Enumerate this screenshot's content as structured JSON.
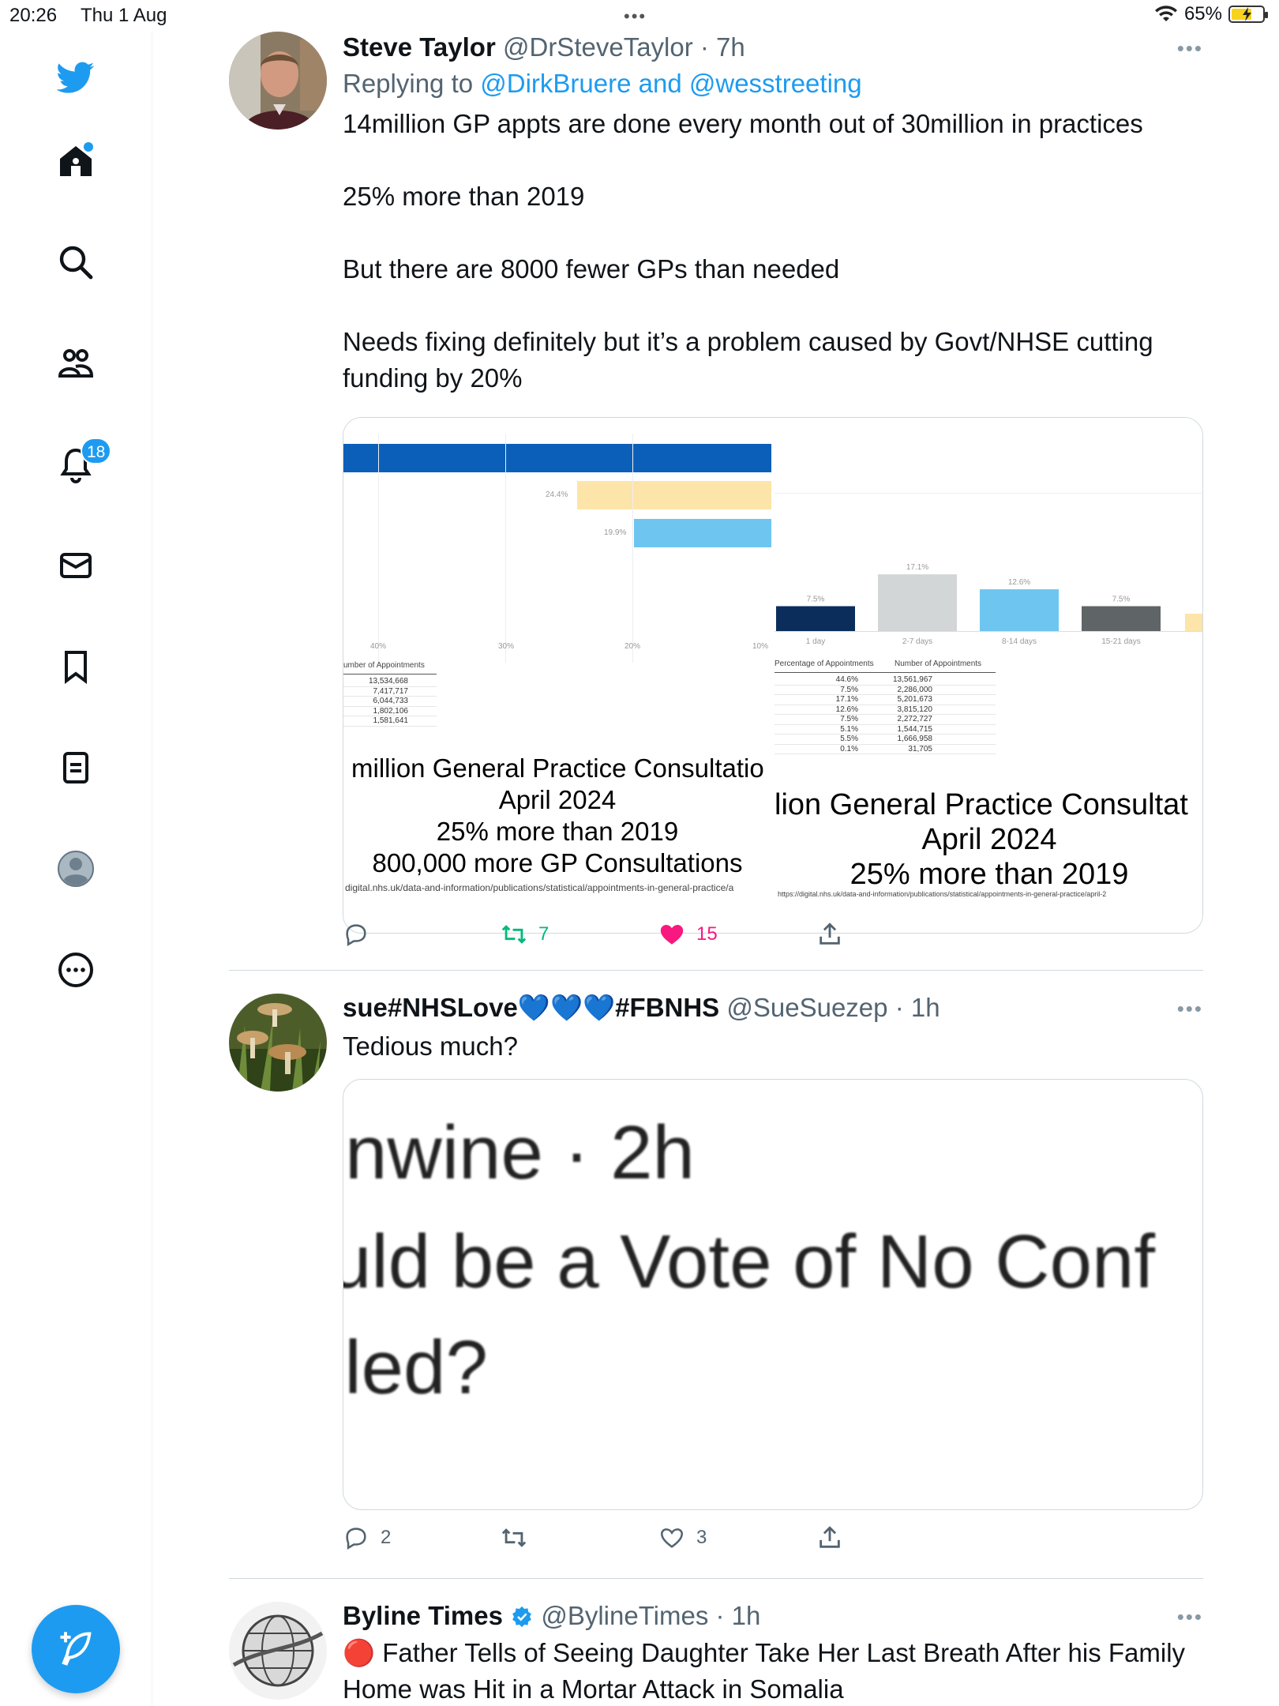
{
  "status_bar": {
    "time": "20:26",
    "date": "Thu 1 Aug",
    "battery": "65%",
    "dots": "•••"
  },
  "sidebar": {
    "notifications_badge": "18"
  },
  "tweets": [
    {
      "name": "Steve Taylor",
      "handle": "@DrSteveTaylor",
      "time": "· 7h",
      "replying_prefix": "Replying to ",
      "replying_to": "@DirkBruere and @wesstreeting",
      "paragraphs": [
        "14million GP appts are done every month out of 30million in practices",
        "25% more than 2019",
        "But there are 8000 fewer GPs than needed",
        "Needs fixing definitely but it’s a problem caused by Govt/NHSE cutting funding by 20%"
      ],
      "image_left": {
        "bar_labels": [
          "24.4%",
          "19.9%"
        ],
        "axis_ticks": [
          "40%",
          "30%",
          "20%",
          "10%"
        ],
        "table_header": "umber of Appointments",
        "table_values": [
          "13,534,668",
          "7,417,717",
          "6,044,733",
          "1,802,106",
          "1,581,641"
        ],
        "caption_lines": [
          "million General Practice Consultatio",
          "April 2024",
          "25% more than 2019",
          "800,000 more GP Consultations"
        ],
        "url": "digital.nhs.uk/data-and-information/publications/statistical/appointments-in-general-practice/a"
      },
      "image_right": {
        "bars": [
          {
            "label": "1 day",
            "pct": "7.5%",
            "value": 7.5,
            "color": "#0b2d5b"
          },
          {
            "label": "2-7 days",
            "pct": "17.1%",
            "value": 17.1,
            "color": "#d3d6d6"
          },
          {
            "label": "8-14 days",
            "pct": "12.6%",
            "value": 12.6,
            "color": "#6ec6f0"
          },
          {
            "label": "15-21 days",
            "pct": "7.5%",
            "value": 7.5,
            "color": "#5f6466"
          }
        ],
        "table_headers": [
          "Percentage of Appointments",
          "Number of Appointments"
        ],
        "table_pct": [
          "44.6%",
          "7.5%",
          "17.1%",
          "12.6%",
          "7.5%",
          "5.1%",
          "5.5%",
          "0.1%"
        ],
        "table_num": [
          "13,561,967",
          "2,286,000",
          "5,201,673",
          "3,815,120",
          "2,272,727",
          "1,544,715",
          "1,666,958",
          "31,705"
        ],
        "caption_lines": [
          "lion General Practice Consultat",
          "April 2024",
          "25% more than 2019"
        ],
        "url": "https://digital.nhs.uk/data-and-information/publications/statistical/appointments-in-general-practice/april-2"
      },
      "retweets": "7",
      "likes": "15"
    },
    {
      "name": "sue#NHSLove💙💙💙#FBNHS",
      "handle": "@SueSuezep",
      "time": "· 1h",
      "text": "Tedious much?",
      "image_lines": [
        "nwine · 2h",
        "uld be a Vote of No Conf",
        "lled?"
      ],
      "replies": "2",
      "likes": "3"
    },
    {
      "name": "Byline Times",
      "handle": "@BylineTimes",
      "time": "· 1h",
      "text": "🔴 Father Tells of Seeing Daughter Take Her Last Breath After his Family Home was Hit in a Mortar Attack in Somalia"
    }
  ],
  "colors": {
    "accent": "#1d9bf0",
    "like": "#f91880",
    "retweet": "#00ba7c"
  }
}
